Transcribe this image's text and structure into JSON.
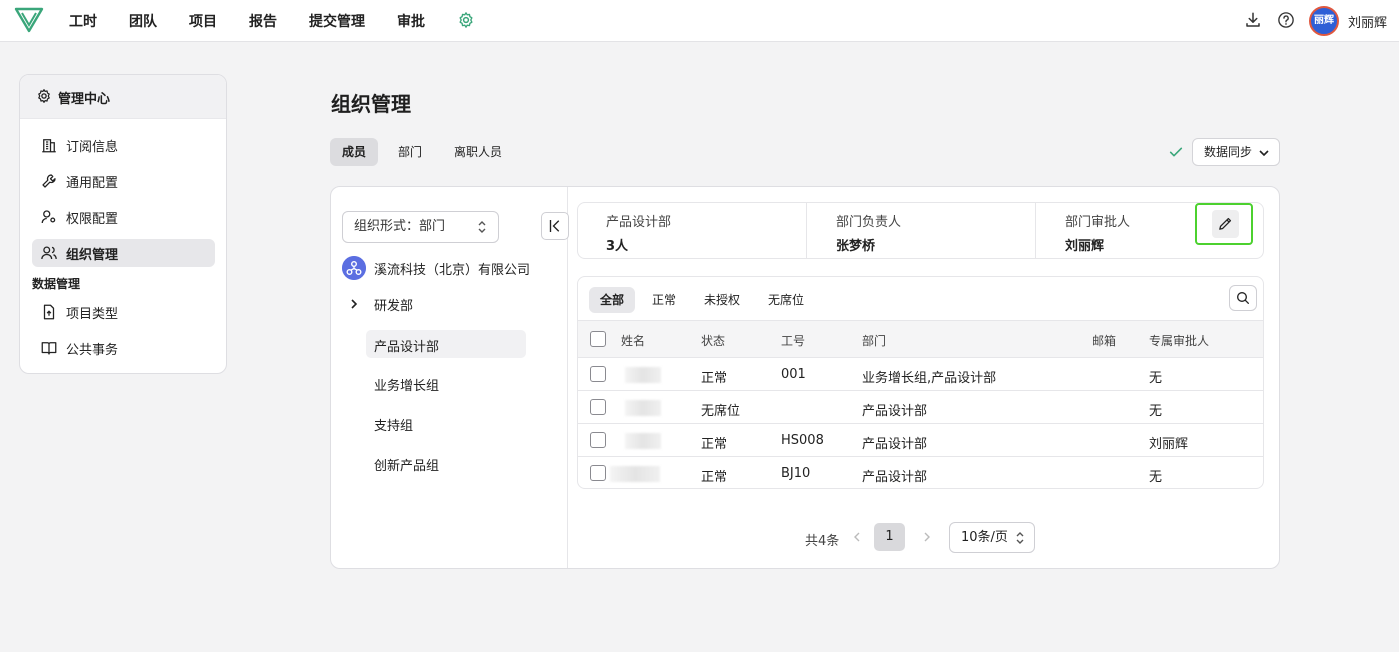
{
  "nav": {
    "items": [
      "工时",
      "团队",
      "项目",
      "报告",
      "提交管理",
      "审批"
    ],
    "user_name": "刘丽辉",
    "avatar_text": "丽辉"
  },
  "sidebar": {
    "header": "管理中心",
    "items": [
      {
        "label": "订阅信息",
        "icon": "building-icon"
      },
      {
        "label": "通用配置",
        "icon": "wrench-icon"
      },
      {
        "label": "权限配置",
        "icon": "user-key-icon"
      },
      {
        "label": "组织管理",
        "icon": "users-icon",
        "active": true
      }
    ],
    "section_label": "数据管理",
    "data_items": [
      {
        "label": "项目类型",
        "icon": "file-upload-icon"
      },
      {
        "label": "公共事务",
        "icon": "book-icon"
      }
    ]
  },
  "page": {
    "title": "组织管理",
    "tabs": [
      "成员",
      "部门",
      "离职人员"
    ],
    "active_tab": "成员",
    "sync_label": "数据同步"
  },
  "org": {
    "select_label": "组织形式：部门",
    "company": "溪流科技（北京）有限公司",
    "nodes": [
      "研发部",
      "产品设计部",
      "业务增长组",
      "支持组",
      "创新产品组"
    ],
    "selected_node": "产品设计部"
  },
  "dept": {
    "name": "产品设计部",
    "count": "3人",
    "leader_label": "部门负责人",
    "leader": "张梦桥",
    "approver_label": "部门审批人",
    "approver": "刘丽辉"
  },
  "filters": [
    "全部",
    "正常",
    "未授权",
    "无席位"
  ],
  "table": {
    "headers": [
      "姓名",
      "状态",
      "工号",
      "部门",
      "邮箱",
      "专属审批人"
    ],
    "rows": [
      {
        "status": "正常",
        "id": "001",
        "dept": "业务增长组,产品设计部",
        "email": "",
        "approver": "无"
      },
      {
        "status": "无席位",
        "id": "",
        "dept": "产品设计部",
        "email": "",
        "approver": "无"
      },
      {
        "status": "正常",
        "id": "HS008",
        "dept": "产品设计部",
        "email": "",
        "approver": "刘丽辉"
      },
      {
        "status": "正常",
        "id": "BJ10",
        "dept": "产品设计部",
        "email": "",
        "approver": "无"
      }
    ]
  },
  "pagination": {
    "total": "共4条",
    "current": "1",
    "page_size": "10条/页"
  },
  "colors": {
    "accent_green": "#4cd12f",
    "gear_green": "#3aa67a",
    "avatar_blue": "#2f5fd6"
  }
}
